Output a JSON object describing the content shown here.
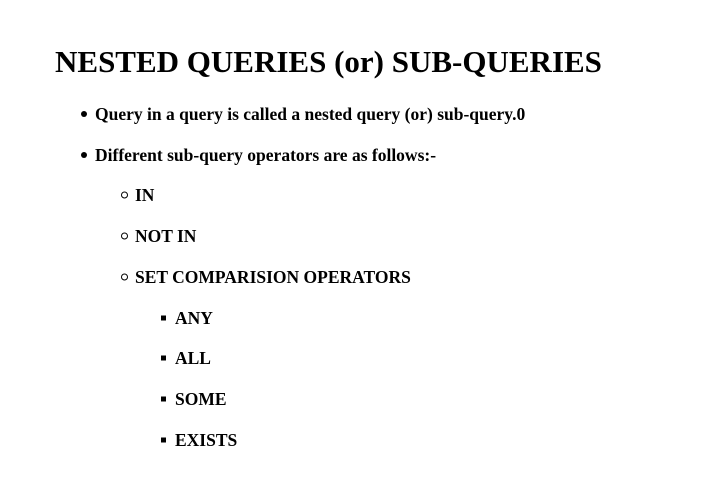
{
  "title": "NESTED QUERIES (or) SUB-QUERIES",
  "level1": [
    "Query in a query is called a nested query (or) sub-query.0",
    "Different sub-query operators are as follows:-"
  ],
  "level2": [
    "IN",
    "NOT IN",
    "SET COMPARISION OPERATORS"
  ],
  "level3": [
    "ANY",
    "ALL",
    "SOME",
    "EXISTS"
  ]
}
